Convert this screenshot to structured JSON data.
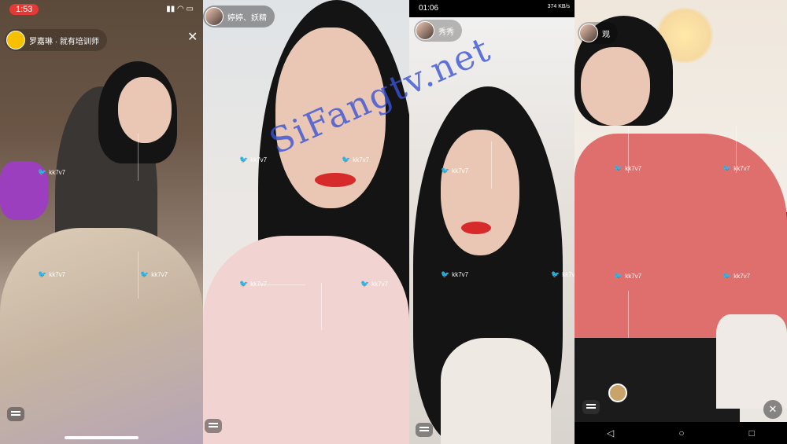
{
  "site_watermark": "SiFangtv.net",
  "stream_watermark": "kk7v7",
  "panels": [
    {
      "status_time": "1:53",
      "host_name": "罗嘉琳 · 就有培训师",
      "has_close": true,
      "bg_color": "#6b5646"
    },
    {
      "host_name": "婷婷、妖精",
      "has_close": false,
      "bg_color": "#e9e7e4"
    },
    {
      "status_time": "01:06",
      "status_right": "374 KB/s",
      "host_name": "秀秀",
      "has_close": false,
      "bg_color": "#e7e2dd"
    },
    {
      "host_name": "观",
      "has_close": true,
      "bg_color": "#efe7dc",
      "nav_buttons": [
        "◁",
        "○",
        "□"
      ]
    }
  ],
  "icons": {
    "close": "close-icon",
    "chat": "chat-icon",
    "twitter": "twitter-bird-icon"
  }
}
